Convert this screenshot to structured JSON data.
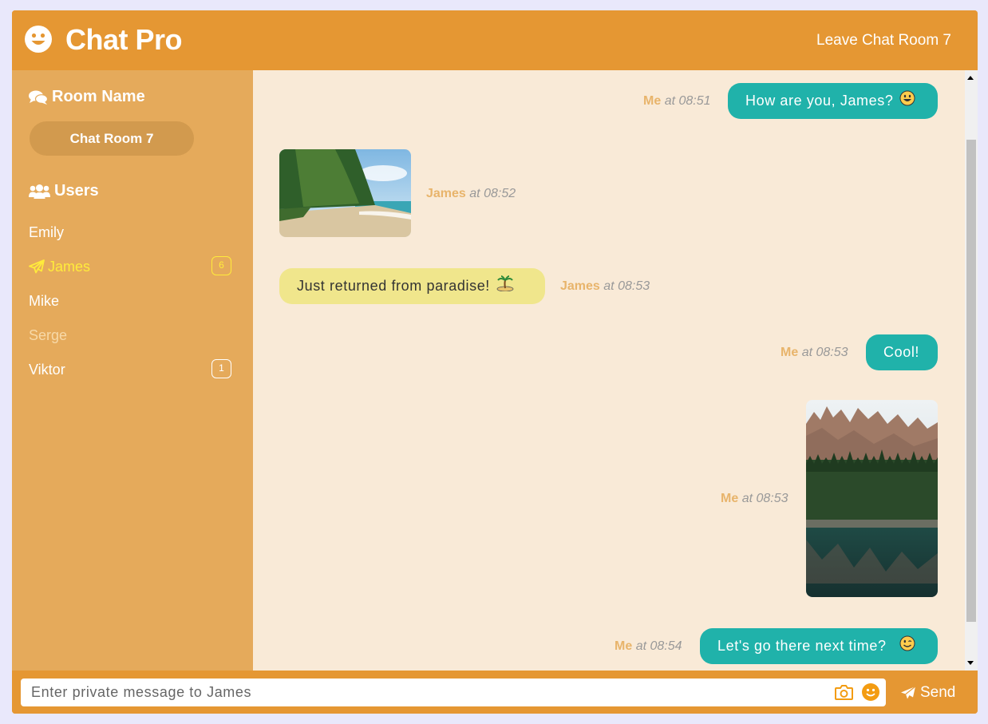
{
  "header": {
    "title": "Chat Pro",
    "logo_icon": "smiley-face-icon",
    "leave_label": "Leave Chat Room 7"
  },
  "sidebar": {
    "room_heading": "Room Name",
    "room_heading_icon": "comments-icon",
    "room_name": "Chat Room 7",
    "users_heading": "Users",
    "users_heading_icon": "users-icon",
    "users": [
      {
        "name": "Emily",
        "status": "online",
        "badge": ""
      },
      {
        "name": "James",
        "status": "active",
        "badge": "6",
        "icon": "paper-plane-icon"
      },
      {
        "name": "Mike",
        "status": "online",
        "badge": ""
      },
      {
        "name": "Serge",
        "status": "offline",
        "badge": ""
      },
      {
        "name": "Viktor",
        "status": "online",
        "badge": "1"
      }
    ]
  },
  "messages": [
    {
      "sender": "Me",
      "time": "at 08:51",
      "type": "text",
      "text": "How are you, James?",
      "emoji": "😃"
    },
    {
      "sender": "James",
      "time": "at 08:52",
      "type": "image",
      "image": "beach-photo"
    },
    {
      "sender": "James",
      "time": "at 08:53",
      "type": "text",
      "text": "Just returned from paradise!",
      "emoji": "🏝️"
    },
    {
      "sender": "Me",
      "time": "at 08:53",
      "type": "text",
      "text": "Cool!",
      "emoji": ""
    },
    {
      "sender": "Me",
      "time": "at 08:53",
      "type": "image",
      "image": "mountain-lake-photo"
    },
    {
      "sender": "Me",
      "time": "at 08:54",
      "type": "text",
      "text": "Let's go there next time?",
      "emoji": "😉"
    }
  ],
  "composer": {
    "placeholder": "Enter private message to James",
    "value": "",
    "camera_icon": "camera-icon",
    "emoji_icon": "smiley-face-icon",
    "send_label": "Send",
    "send_icon": "paper-plane-icon"
  },
  "colors": {
    "brand": "#e59733",
    "sidebar": "#e5aa5b",
    "chat_bg": "#f9ead7",
    "my_bubble": "#20b2aa",
    "their_bubble": "#f0e68c",
    "active_user": "#ffeb3b"
  }
}
